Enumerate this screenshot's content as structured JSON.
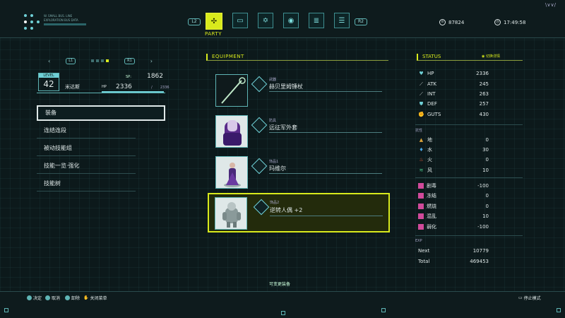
{
  "header": {
    "tiny_text_1": "W. SMALL BUS. LINE",
    "tiny_text_2": "EXPLORATION BUS DATA",
    "shoulder_left": "L2",
    "shoulder_right": "R2",
    "active_tab_label": "PARTY",
    "tabs": [
      {
        "name": "party",
        "icon": "party-icon",
        "glyph": "✣"
      },
      {
        "name": "card",
        "icon": "card-icon",
        "glyph": "▭"
      },
      {
        "name": "emblem",
        "icon": "emblem-icon",
        "glyph": "✡"
      },
      {
        "name": "bulb",
        "icon": "bulb-icon",
        "glyph": "◉"
      },
      {
        "name": "list",
        "icon": "list-icon",
        "glyph": "≣"
      },
      {
        "name": "settings",
        "icon": "settings-icon",
        "glyph": "☰"
      }
    ],
    "currency": "87824",
    "time": "17:49:58",
    "corner_badge": "\\∨∨/"
  },
  "character": {
    "page_left": "L1",
    "page_right": "R1",
    "level_label": "LEVEL",
    "level": "42",
    "name": "米达斯",
    "sp_label": "SP:",
    "sp": "1862",
    "hp_label": "HP",
    "hp": "2336",
    "hp_sep": "/",
    "hp_max": "2336"
  },
  "menu": {
    "items": [
      "装备",
      "连结连段",
      "被动技能组",
      "技能一览·强化",
      "技能树"
    ]
  },
  "equipment": {
    "title": "EQUIPMENT",
    "slots": [
      {
        "type": "武器",
        "name": "赫贝里姆锤杖"
      },
      {
        "type": "防具",
        "name": "远征军外套"
      },
      {
        "type": "饰品1",
        "name": "玛维尔"
      },
      {
        "type": "饰品2",
        "name": "逆转人偶 +2"
      }
    ],
    "hint": "可变更装备"
  },
  "status": {
    "title": "STATUS",
    "switch_label": "切换详情",
    "stats": [
      {
        "label": "HP",
        "value": "2336",
        "icon": "heart-icon",
        "glyph": "♥",
        "color": "#6fd0d6"
      },
      {
        "label": "ATK",
        "value": "245",
        "icon": "sword-icon",
        "glyph": "⟋",
        "color": "#cfd8d8"
      },
      {
        "label": "INT",
        "value": "263",
        "icon": "wand-icon",
        "glyph": "⟋",
        "color": "#cfd8d8"
      },
      {
        "label": "DEF",
        "value": "257",
        "icon": "shield-icon",
        "glyph": "⛊",
        "color": "#6fd0d6"
      },
      {
        "label": "GUTS",
        "value": "430",
        "icon": "guts-icon",
        "glyph": "✊",
        "color": "#6fd0d6"
      }
    ],
    "resist_label": "抗性",
    "resists": [
      {
        "label": "地",
        "value": "0",
        "icon": "earth-icon",
        "glyph": "▲",
        "color": "#d9a23a"
      },
      {
        "label": "水",
        "value": "30",
        "icon": "water-icon",
        "glyph": "♦",
        "color": "#4aa8e8"
      },
      {
        "label": "火",
        "value": "0",
        "icon": "fire-icon",
        "glyph": "♨",
        "color": "#e85a3a"
      },
      {
        "label": "风",
        "value": "10",
        "icon": "wind-icon",
        "glyph": "≋",
        "color": "#4ac88a"
      }
    ],
    "ailments": [
      {
        "label": "剧毒",
        "value": "-100",
        "icon": "poison-icon",
        "color": "#d04a9a"
      },
      {
        "label": "冻结",
        "value": "0",
        "icon": "freeze-icon",
        "color": "#d04a9a"
      },
      {
        "label": "燃烧",
        "value": "0",
        "icon": "burn-icon",
        "color": "#d04a9a"
      },
      {
        "label": "混乱",
        "value": "10",
        "icon": "confuse-icon",
        "color": "#d04a9a"
      },
      {
        "label": "弱化",
        "value": "-100",
        "icon": "weaken-icon",
        "color": "#d04a9a"
      }
    ],
    "exp_label": "EXP",
    "next_label": "Next",
    "next": "10779",
    "total_label": "Total",
    "total": "469453"
  },
  "footer": {
    "confirm": "决定",
    "cancel": "取消",
    "unequip": "卸除",
    "close_menu": "关闭菜单",
    "stop_mode": "停止模式"
  }
}
